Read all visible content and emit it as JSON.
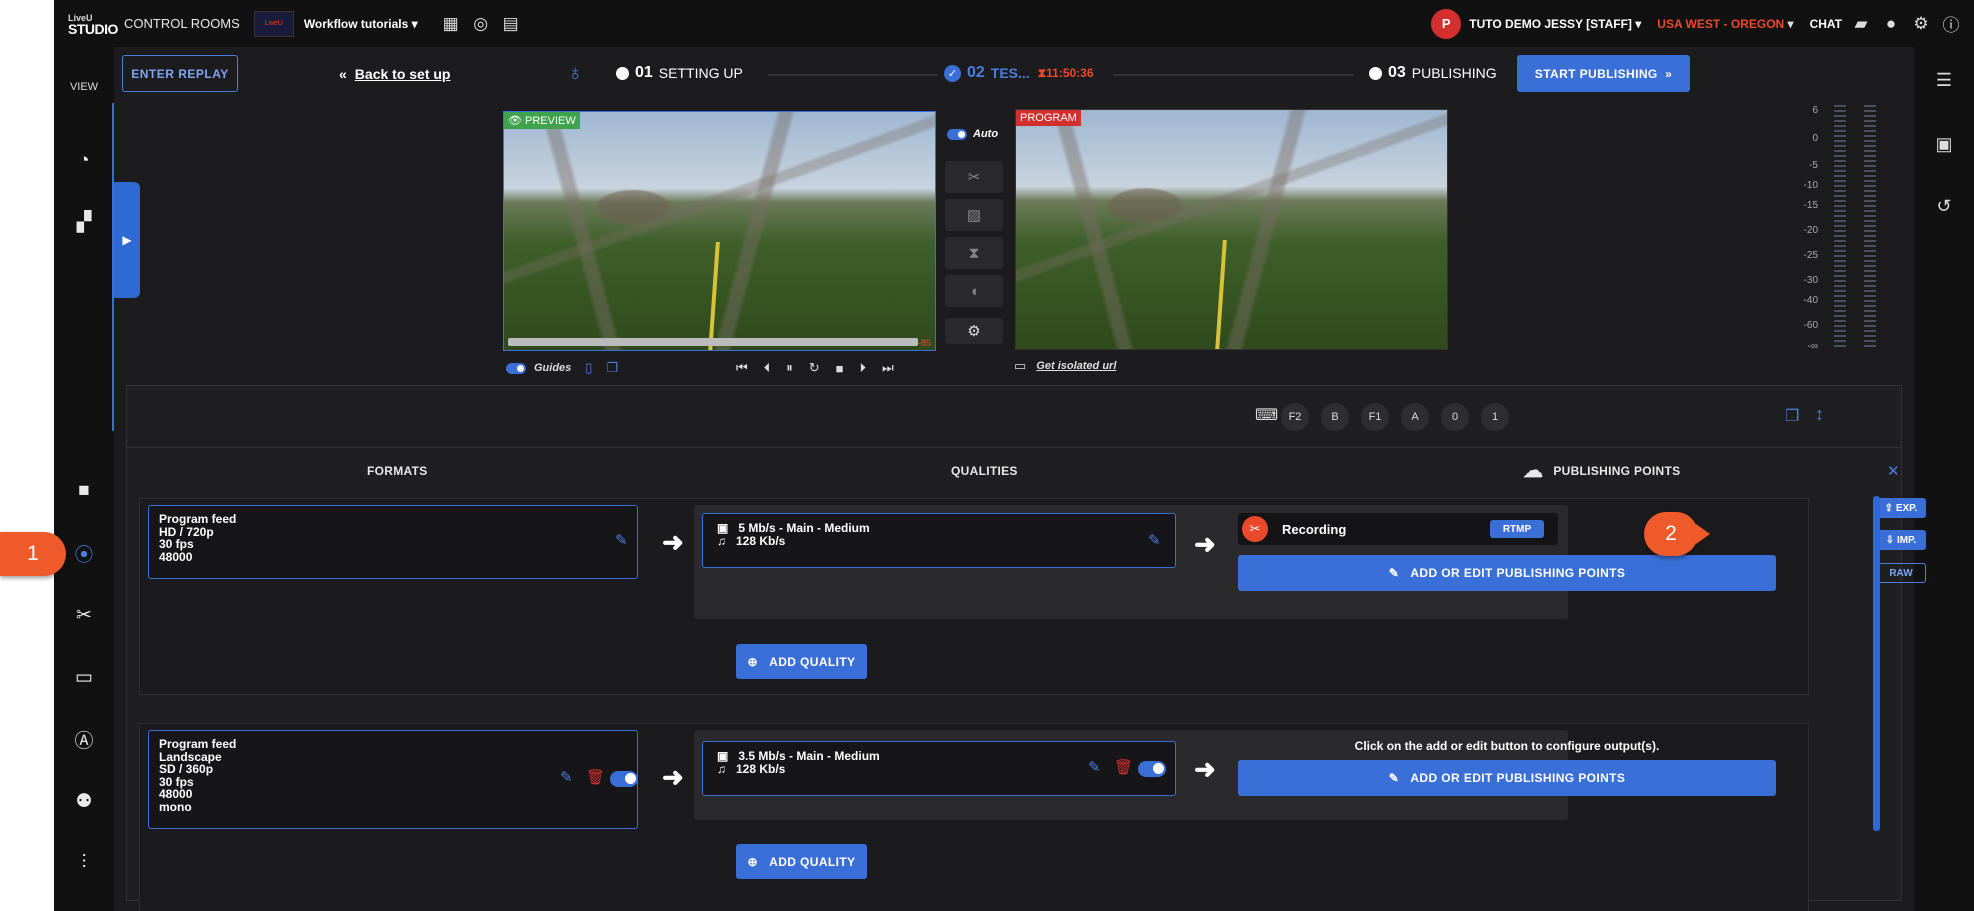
{
  "topbar": {
    "logo_small": "LiveU",
    "logo_big": "STUDIO",
    "control_rooms": "CONTROL ROOMS",
    "thumb_text": "LiveU",
    "workflow": "Workflow tutorials",
    "user_initial": "P",
    "user_name": "TUTO DEMO JESSY [STAFF]",
    "region": "USA WEST - OREGON",
    "chat": "CHAT"
  },
  "sidebar": {
    "view": "VIEW"
  },
  "steps": {
    "enter_replay": "ENTER REPLAY",
    "back": "Back to set up",
    "s1_num": "01",
    "s1_label": "SETTING UP",
    "s2_num": "02",
    "s2_label": "TES...",
    "timer": "11:50:36",
    "s3_num": "03",
    "s3_label": "PUBLISHING",
    "start_publishing": "START PUBLISHING"
  },
  "monitors": {
    "preview_label": "PREVIEW",
    "program_label": "PROGRAM",
    "auto": "Auto",
    "guides": "Guides",
    "isolated": "Get isolated url",
    "preview_time": "-85"
  },
  "vu_labels": [
    "6",
    "0",
    "-5",
    "-10",
    "-15",
    "-20",
    "-25",
    "-30",
    "-40",
    "-60",
    "-∞"
  ],
  "panel": {
    "keys": [
      "F2",
      "B",
      "F1",
      "A",
      "0",
      "1"
    ],
    "col_formats": "FORMATS",
    "col_qualities": "QUALITIES",
    "col_publishing": "PUBLISHING POINTS",
    "exp": "EXP.",
    "imp": "IMP.",
    "raw": "RAW",
    "group1": {
      "format_lines": [
        "Program feed",
        "HD / 720p",
        "30 fps",
        "48000"
      ],
      "quality_video": "5 Mb/s  -  Main  -  Medium",
      "quality_audio": "128 Kb/s",
      "recording": "Recording",
      "rtmp": "RTMP",
      "add_edit": "ADD OR EDIT PUBLISHING POINTS",
      "add_quality": "ADD QUALITY"
    },
    "group2": {
      "format_lines": [
        "Program feed",
        "Landscape",
        "SD / 360p",
        "30 fps",
        "48000",
        "mono"
      ],
      "quality_video": "3.5 Mb/s  -  Main  -  Medium",
      "quality_audio": "128 Kb/s",
      "hint": "Click on the add or edit button to configure output(s).",
      "add_edit": "ADD OR EDIT PUBLISHING POINTS",
      "add_quality": "ADD QUALITY"
    }
  },
  "callouts": {
    "c1": "1",
    "c2": "2"
  },
  "colors": {
    "accent": "#3a6fd8",
    "alert": "#e94a2b",
    "preview": "#3fa34d",
    "program": "#d32f2f"
  }
}
